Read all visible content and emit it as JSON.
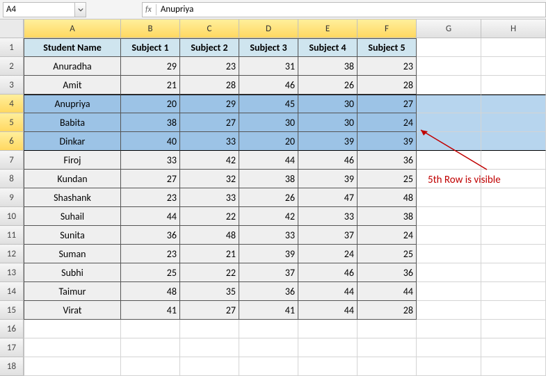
{
  "formulaBar": {
    "nameBox": "A4",
    "fxSymbol": "fx",
    "formulaContent": "Anupriya"
  },
  "columns": [
    "A",
    "B",
    "C",
    "D",
    "E",
    "F",
    "G",
    "H"
  ],
  "highlightedCols": [
    "A",
    "B",
    "C",
    "D",
    "E",
    "F"
  ],
  "selectedRows": [
    4,
    5,
    6
  ],
  "rowCount": 18,
  "tableHeaders": [
    "Student Name",
    "Subject 1",
    "Subject 2",
    "Subject 3",
    "Subject 4",
    "Subject 5"
  ],
  "tableRows": [
    {
      "name": "Anuradha",
      "scores": [
        29,
        23,
        31,
        38,
        23
      ]
    },
    {
      "name": "Amit",
      "scores": [
        21,
        28,
        46,
        26,
        28
      ]
    },
    {
      "name": "Anupriya",
      "scores": [
        20,
        29,
        45,
        30,
        27
      ]
    },
    {
      "name": "Babita",
      "scores": [
        38,
        27,
        30,
        30,
        24
      ]
    },
    {
      "name": "Dinkar",
      "scores": [
        40,
        33,
        20,
        39,
        39
      ]
    },
    {
      "name": "Firoj",
      "scores": [
        33,
        42,
        44,
        46,
        36
      ]
    },
    {
      "name": "Kundan",
      "scores": [
        27,
        32,
        38,
        39,
        25
      ]
    },
    {
      "name": "Shashank",
      "scores": [
        23,
        33,
        26,
        47,
        48
      ]
    },
    {
      "name": "Suhail",
      "scores": [
        44,
        22,
        42,
        33,
        38
      ]
    },
    {
      "name": "Sunita",
      "scores": [
        36,
        48,
        33,
        37,
        24
      ]
    },
    {
      "name": "Suman",
      "scores": [
        23,
        21,
        39,
        24,
        25
      ]
    },
    {
      "name": "Subhi",
      "scores": [
        25,
        22,
        37,
        46,
        36
      ]
    },
    {
      "name": "Taimur",
      "scores": [
        48,
        35,
        36,
        44,
        44
      ]
    },
    {
      "name": "Virat",
      "scores": [
        41,
        27,
        41,
        44,
        28
      ]
    }
  ],
  "annotation": "5th Row is visible"
}
